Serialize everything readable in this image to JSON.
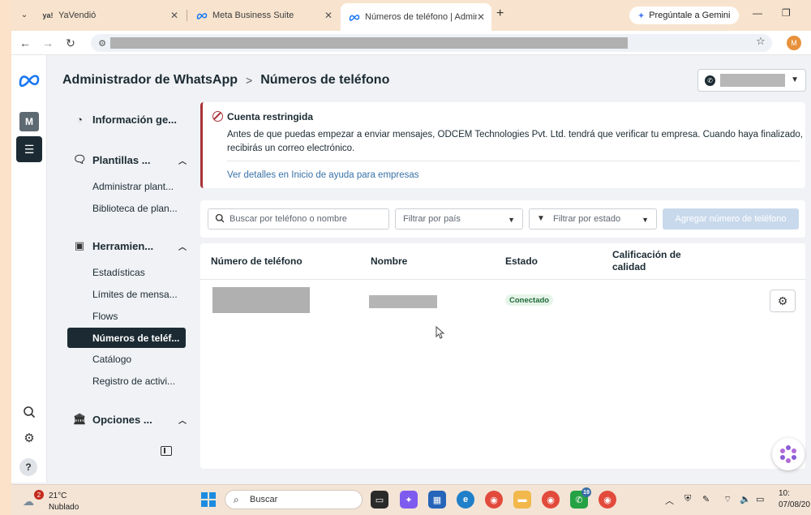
{
  "browser": {
    "tabs": [
      {
        "label": "YaVendió",
        "icon": "ya!"
      },
      {
        "label": "Meta Business Suite",
        "icon": "meta"
      },
      {
        "label": "Números de teléfono | Adminis",
        "icon": "meta"
      }
    ],
    "gemini_label": "Pregúntale a Gemini",
    "profile_initial": "M"
  },
  "rail": {
    "account_initial": "M",
    "help_label": "?"
  },
  "header": {
    "breadcrumb_root": "Administrador de WhatsApp",
    "breadcrumb_separator": ">",
    "breadcrumb_current": "Números de teléfono"
  },
  "sidenav": {
    "groups": [
      {
        "label": "Información ge...",
        "icon": "gauge-icon"
      },
      {
        "label": "Plantillas ...",
        "icon": "chat-icon",
        "items": [
          "Administrar plant...",
          "Biblioteca de plan..."
        ]
      },
      {
        "label": "Herramien...",
        "icon": "toolbox-icon",
        "items": [
          "Estadísticas",
          "Límites de mensa...",
          "Flows",
          "Números de teléf...",
          "Catálogo",
          "Registro de activi..."
        ]
      },
      {
        "label": "Opciones ...",
        "icon": "bank-icon"
      }
    ]
  },
  "alert": {
    "title": "Cuenta restringida",
    "body": "Antes de que puedas empezar a enviar mensajes, ODCEM Technologies Pvt. Ltd. tendrá que verificar tu empresa. Cuando haya finalizado, recibirás un correo electrónico.",
    "link": "Ver detalles en Inicio de ayuda para empresas",
    "accent_color": "#a83237"
  },
  "filters": {
    "search_placeholder": "Buscar por teléfono o nombre",
    "country_placeholder": "Filtrar por país",
    "status_placeholder": "Filtrar por estado",
    "add_button": "Agregar número de teléfono"
  },
  "table": {
    "columns": [
      "Número de teléfono",
      "Nombre",
      "Estado",
      "Calificación de calidad"
    ],
    "rows": [
      {
        "status": "Conectado"
      }
    ]
  },
  "taskbar": {
    "weather_temp": "21°C",
    "weather_condition": "Nublado",
    "weather_badge": "2",
    "search_label": "Buscar",
    "badge_whatsapp": "19",
    "clock_time": "10:",
    "clock_date": "07/08/20"
  }
}
